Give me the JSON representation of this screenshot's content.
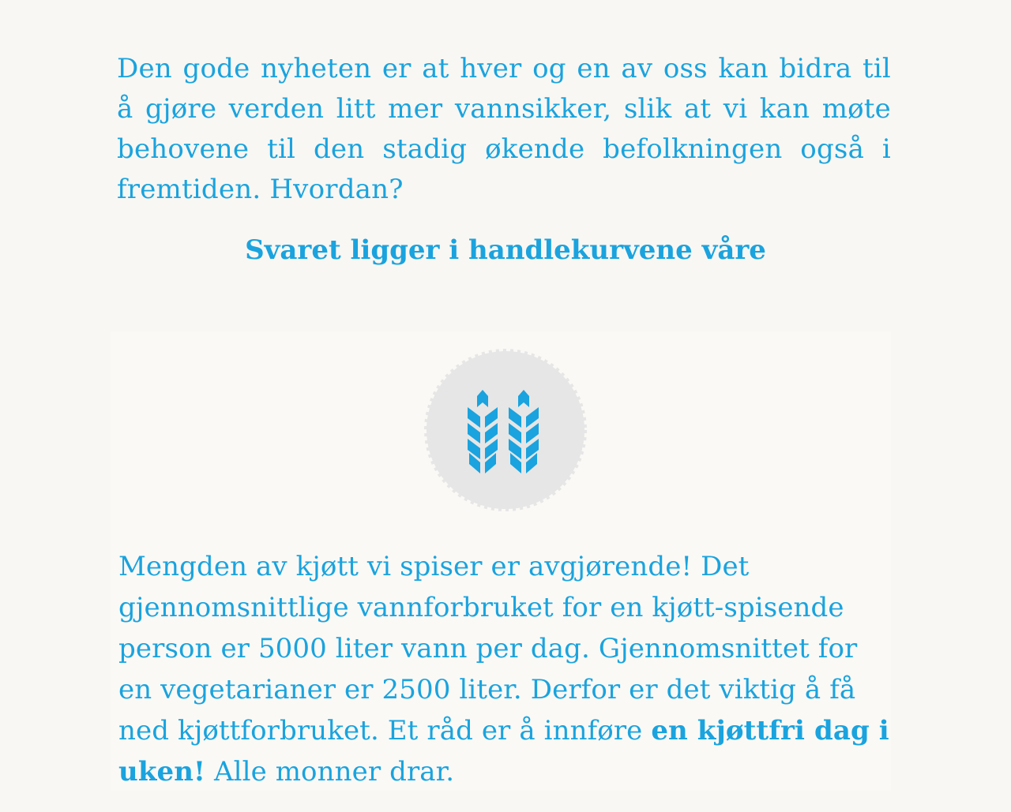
{
  "intro": {
    "text": "Den gode nyheten er at hver og en av oss kan bidra til å gjøre verden litt mer vannsikker, slik at vi kan møte behovene til den stadig økende befolkningen også i fremtiden. Hvordan?"
  },
  "section": {
    "heading": "Svaret ligger i handlekurvene våre"
  },
  "card": {
    "icon": "wheat-icon",
    "badge_color": "#e6e6e6",
    "icon_color": "#1aa3de",
    "text_before": "Mengden av kjøtt vi spiser er avgjørende! Det gjennomsnittlige vannforbruket for en kjøtt-spisende person er 5000 liter vann per dag. Gjennomsnittet for en vegetarianer er 2500 liter. Derfor er det viktig å få ned kjøttforbruket. Et råd er å innføre ",
    "text_bold": "en kjøttfri dag i uken!",
    "text_after": " Alle monner drar."
  }
}
